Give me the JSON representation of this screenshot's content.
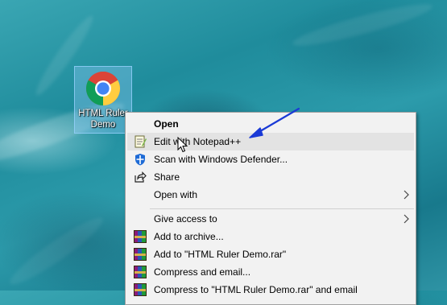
{
  "desktop": {
    "icon_label": "HTML Ruler Demo",
    "icon_name": "chrome-icon"
  },
  "context_menu": {
    "items": [
      {
        "label": "Open",
        "bold": true,
        "icon": null,
        "submenu": false
      },
      {
        "label": "Edit with Notepad++",
        "bold": false,
        "icon": "notepad-plus-plus-icon",
        "submenu": false,
        "highlighted": true
      },
      {
        "label": "Scan with Windows Defender...",
        "bold": false,
        "icon": "windows-defender-icon",
        "submenu": false
      },
      {
        "label": "Share",
        "bold": false,
        "icon": "share-icon",
        "submenu": false
      },
      {
        "label": "Open with",
        "bold": false,
        "icon": null,
        "submenu": true
      },
      {
        "label": "Give access to",
        "bold": false,
        "icon": null,
        "submenu": true
      },
      {
        "label": "Add to archive...",
        "bold": false,
        "icon": "winrar-icon",
        "submenu": false
      },
      {
        "label": "Add to \"HTML Ruler Demo.rar\"",
        "bold": false,
        "icon": "winrar-icon",
        "submenu": false
      },
      {
        "label": "Compress and email...",
        "bold": false,
        "icon": "winrar-icon",
        "submenu": false
      },
      {
        "label": "Compress to \"HTML Ruler Demo.rar\" and email",
        "bold": false,
        "icon": "winrar-icon",
        "submenu": false
      }
    ]
  },
  "colors": {
    "menu_background": "#f2f2f2",
    "highlight": "#e3e3e3",
    "annotation_arrow": "#1a3ad6",
    "selection": "#99d1ff"
  }
}
